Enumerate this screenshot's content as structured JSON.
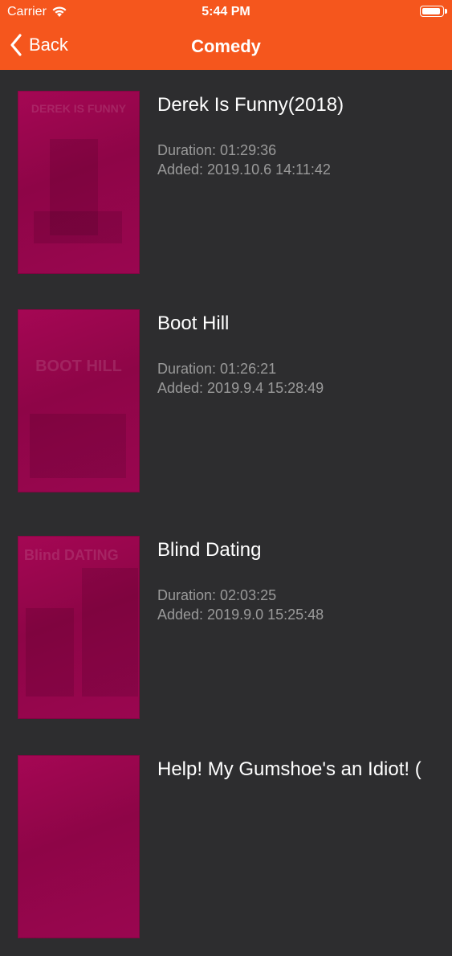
{
  "status_bar": {
    "carrier": "Carrier",
    "time": "5:44 PM"
  },
  "nav": {
    "back_label": "Back",
    "title": "Comedy"
  },
  "colors": {
    "accent": "#f5561d",
    "background": "#2d2d2f",
    "poster_tint": "#a50754",
    "meta_text": "#9a9a9a"
  },
  "movies": [
    {
      "title": "Derek Is Funny(2018)",
      "duration": "Duration: 01:29:36",
      "added": "Added: 2019.10.6 14:11:42",
      "poster_text": "DEREK IS FUNNY"
    },
    {
      "title": "Boot Hill",
      "duration": "Duration: 01:26:21",
      "added": "Added: 2019.9.4 15:28:49",
      "poster_text": "BOOT HILL"
    },
    {
      "title": "Blind Dating",
      "duration": "Duration: 02:03:25",
      "added": "Added: 2019.9.0 15:25:48",
      "poster_text": "Blind DATING"
    },
    {
      "title": "Help! My Gumshoe's an Idiot! (",
      "duration": "",
      "added": "",
      "poster_text": ""
    }
  ]
}
